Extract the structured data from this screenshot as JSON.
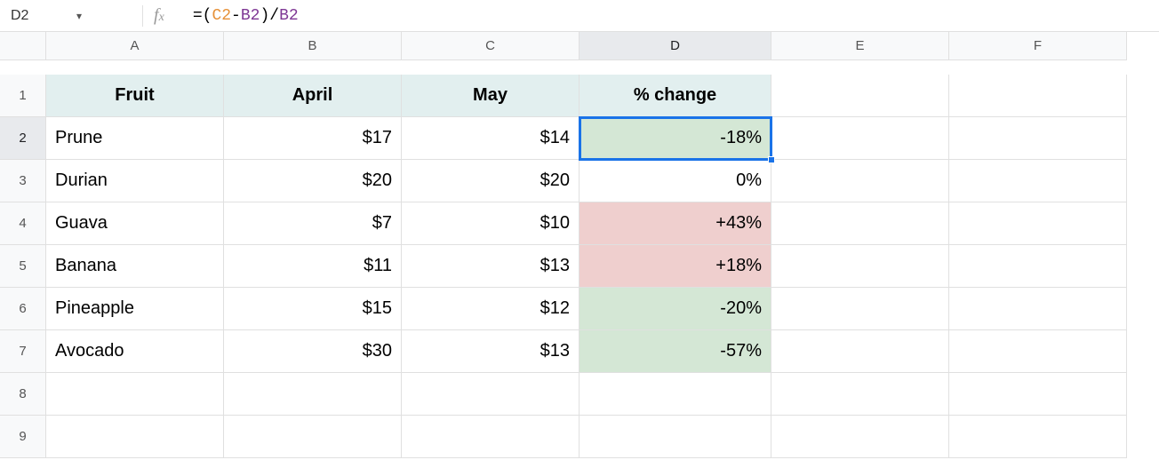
{
  "formula_bar": {
    "cell_ref": "D2",
    "formula": {
      "eq": "=",
      "op": "(",
      "c2": "C2",
      "minus": "-",
      "b2": "B2",
      "cp": ")",
      "slash": "/",
      "b2b": "B2"
    }
  },
  "col_headers": [
    "A",
    "B",
    "C",
    "D",
    "E",
    "F"
  ],
  "row_headers": [
    "1",
    "2",
    "3",
    "4",
    "5",
    "6",
    "7",
    "8",
    "9"
  ],
  "selected_col": "D",
  "selected_row": "2",
  "header_row": {
    "A": "Fruit",
    "B": "April",
    "C": "May",
    "D": "% change"
  },
  "rows": [
    {
      "A": "Prune",
      "B": "$17",
      "C": "$14",
      "D": "-18%",
      "D_color": "green",
      "D_selected": true
    },
    {
      "A": "Durian",
      "B": "$20",
      "C": "$20",
      "D": "0%",
      "D_color": ""
    },
    {
      "A": "Guava",
      "B": "$7",
      "C": "$10",
      "D": "+43%",
      "D_color": "red"
    },
    {
      "A": "Banana",
      "B": "$11",
      "C": "$13",
      "D": "+18%",
      "D_color": "red"
    },
    {
      "A": "Pineapple",
      "B": "$15",
      "C": "$12",
      "D": "-20%",
      "D_color": "green"
    },
    {
      "A": "Avocado",
      "B": "$30",
      "C": "$13",
      "D": "-57%",
      "D_color": "green"
    }
  ]
}
